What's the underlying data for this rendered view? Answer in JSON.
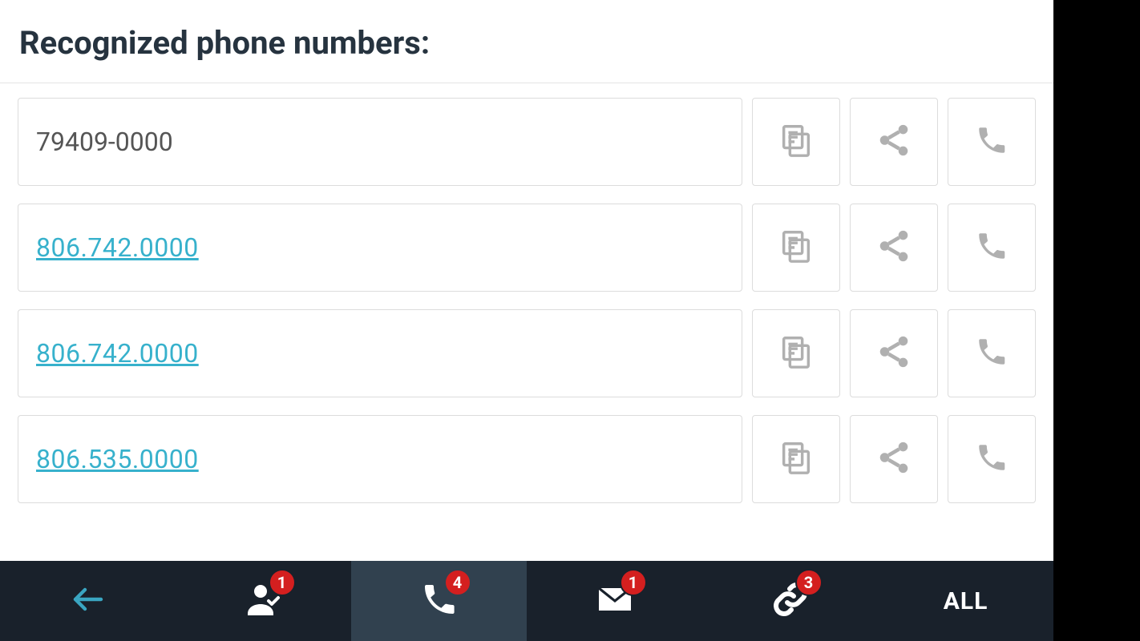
{
  "header": {
    "title": "Recognized phone numbers:"
  },
  "numbers": [
    {
      "text": "79409-0000",
      "link": false
    },
    {
      "text": "806.742.0000",
      "link": true
    },
    {
      "text": "806.742.0000",
      "link": true
    },
    {
      "text": "806.535.0000",
      "link": true
    }
  ],
  "bottomnav": {
    "back_icon": "back",
    "contacts_badge": "1",
    "phone_badge": "4",
    "mail_badge": "1",
    "link_badge": "3",
    "all_label": "ALL",
    "active": "phone"
  },
  "colors": {
    "link": "#37b1cc",
    "badge": "#d41f1f",
    "nav_bg": "#19212b",
    "nav_active": "#31414f"
  }
}
